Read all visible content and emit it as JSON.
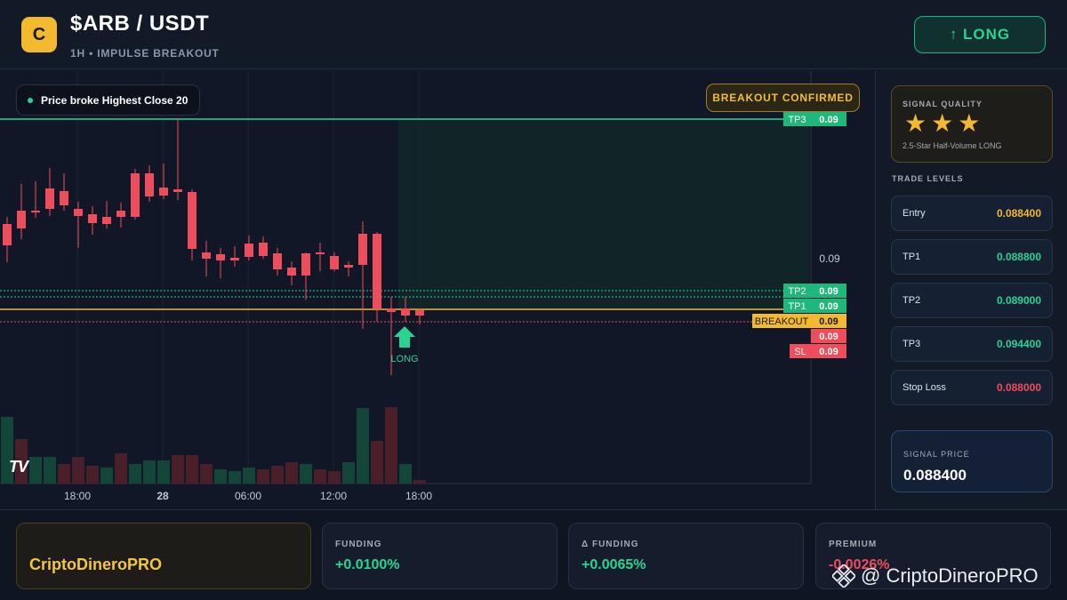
{
  "header": {
    "logo_letter": "C",
    "title": "$ARB / USDT",
    "subtitle": "1H • IMPULSE BREAKOUT",
    "long_button": "↑ LONG"
  },
  "chart": {
    "status_badge": "Price broke Highest Close 20",
    "confirm_badge": "BREAKOUT CONFIRMED",
    "price_axis_label": "0.09",
    "signal_label": "LONG",
    "tv_logo": "TV",
    "x_labels": [
      "18:00",
      "28",
      "06:00",
      "12:00",
      "18:00"
    ],
    "level_tags": [
      {
        "name": "TP3",
        "value": "0.09",
        "color": "#1fb87a"
      },
      {
        "name": "TP2",
        "value": "0.09",
        "color": "#1fb87a"
      },
      {
        "name": "TP1",
        "value": "0.09",
        "color": "#1fb87a"
      },
      {
        "name": "BREAKOUT",
        "value": "0.09",
        "color": "#f3b92f"
      },
      {
        "name": "",
        "value": "0.09",
        "color": "#ef4d5c"
      },
      {
        "name": "SL",
        "value": "0.09",
        "color": "#ef4d5c"
      }
    ],
    "colors": {
      "up": "#1fb87a",
      "down": "#ef4d5c",
      "entry": "#f3b92f"
    }
  },
  "sidebar": {
    "signal_quality_label": "SIGNAL QUALITY",
    "stars": 3,
    "quality_desc": "2.5-Star Half-Volume LONG",
    "levels_title": "TRADE LEVELS",
    "levels": [
      {
        "name": "Entry",
        "value": "0.088400",
        "color": "#f3b92f"
      },
      {
        "name": "TP1",
        "value": "0.088800",
        "color": "#27d591"
      },
      {
        "name": "TP2",
        "value": "0.089000",
        "color": "#27d591"
      },
      {
        "name": "TP3",
        "value": "0.094400",
        "color": "#27d591"
      },
      {
        "name": "Stop Loss",
        "value": "0.088000",
        "color": "#ef4d5c"
      }
    ],
    "signal_price_label": "SIGNAL PRICE",
    "signal_price": "0.088400"
  },
  "footer": {
    "brand": "CriptoDineroPRO",
    "stats": [
      {
        "label": "FUNDING",
        "value": "+0.0100%",
        "color": "#27d591"
      },
      {
        "label": "Δ FUNDING",
        "value": "+0.0065%",
        "color": "#27d591"
      },
      {
        "label": "PREMIUM",
        "value": "-0.0026%",
        "color": "#ef4d5c"
      }
    ],
    "watermark": "@ CriptoDineroPRO"
  }
}
